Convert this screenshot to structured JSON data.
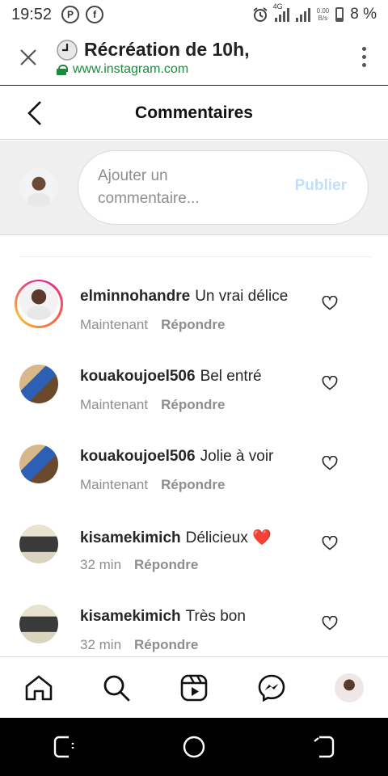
{
  "status_bar": {
    "time": "19:52",
    "network": "4G",
    "speed": "0.00",
    "speed_unit": "B/s",
    "battery": "8 %"
  },
  "browser": {
    "tab_title": "Récréation de 10h,",
    "url": "www.instagram.com",
    "url_color": "#1a8b3a"
  },
  "page": {
    "title": "Commentaires"
  },
  "composer": {
    "placeholder": "Ajouter un commentaire...",
    "publish_label": "Publier"
  },
  "comments": [
    {
      "username": "elminnohandre",
      "text": "Un vrai délice",
      "time": "Maintenant",
      "reply_label": "Répondre",
      "has_story": true
    },
    {
      "username": "kouakoujoel506",
      "text": "Bel entré",
      "time": "Maintenant",
      "reply_label": "Répondre",
      "has_story": false
    },
    {
      "username": "kouakoujoel506",
      "text": "Jolie à voir",
      "time": "Maintenant",
      "reply_label": "Répondre",
      "has_story": false
    },
    {
      "username": "kisamekimich",
      "text": "Délicieux ❤️",
      "time": "32 min",
      "reply_label": "Répondre",
      "has_story": false
    },
    {
      "username": "kisamekimich",
      "text": "Très bon",
      "time": "32 min",
      "reply_label": "Répondre",
      "has_story": false
    }
  ],
  "bottom_nav": [
    "home-icon",
    "search-icon",
    "reels-icon",
    "messenger-icon",
    "profile-avatar"
  ],
  "colors": {
    "publish_disabled": "#c0dffd",
    "secondary_text": "#8e8e8e",
    "composer_bg": "#efefef"
  }
}
